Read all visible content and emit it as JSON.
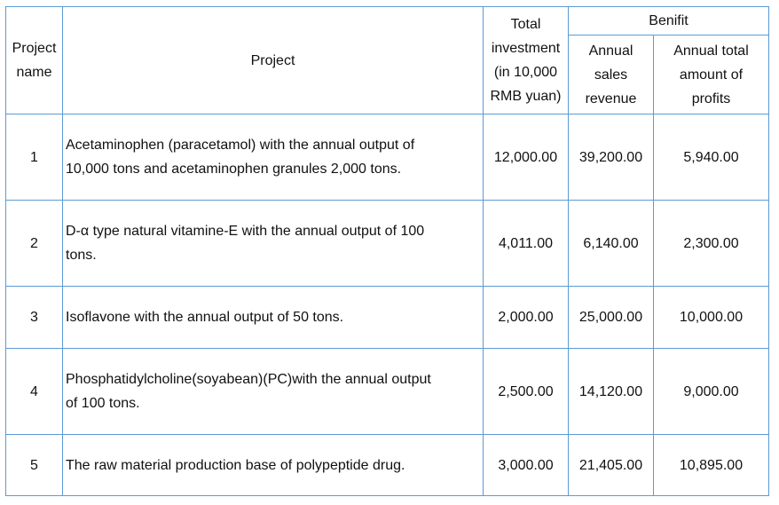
{
  "header": {
    "project_name": [
      "Project",
      "name"
    ],
    "project": "Project",
    "total_investment": [
      "Total",
      "investment",
      "(in 10,000",
      "RMB yuan)"
    ],
    "benefit": "Benifit",
    "annual_sales_revenue": [
      "Annual",
      "sales",
      "revenue"
    ],
    "annual_total_profits": [
      "Annual total",
      "amount of",
      "profits"
    ]
  },
  "rows": [
    {
      "no": "1",
      "project": [
        "Acetaminophen (paracetamol) with the annual output of",
        "10,000 tons and acetaminophen granules 2,000 tons."
      ],
      "investment": "12,000.00",
      "revenue": "39,200.00",
      "profits": "5,940.00"
    },
    {
      "no": "2",
      "project": [
        "D-α type natural vitamine-E with the annual output of 100",
        "tons."
      ],
      "investment": "4,011.00",
      "revenue": "6,140.00",
      "profits": "2,300.00"
    },
    {
      "no": "3",
      "project": [
        "Isoflavone with the annual output of 50 tons."
      ],
      "investment": "2,000.00",
      "revenue": "25,000.00",
      "profits": "10,000.00"
    },
    {
      "no": "4",
      "project": [
        "Phosphatidylcholine(soyabean)(PC)with the annual output",
        "of 100 tons."
      ],
      "investment": "2,500.00",
      "revenue": "14,120.00",
      "profits": "9,000.00"
    },
    {
      "no": "5",
      "project": [
        "The raw material production base of polypeptide drug."
      ],
      "investment": "3,000.00",
      "revenue": "21,405.00",
      "profits": "10,895.00"
    }
  ]
}
